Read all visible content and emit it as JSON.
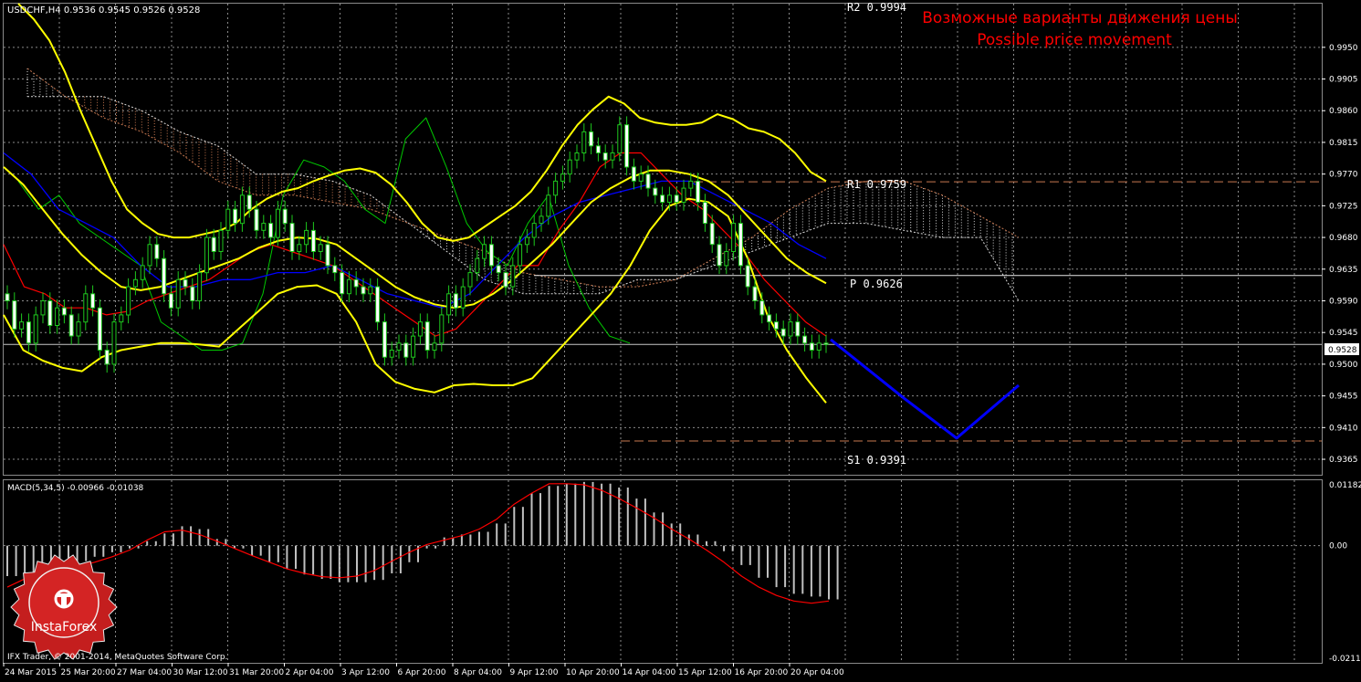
{
  "window": {
    "symbol_header": "USDCHF,H4  0.9536 0.9545 0.9526 0.9528",
    "macd_header": "MACD(5,34,5) -0.00966 -0.01038",
    "copyright": "IFX Trader, © 2001-2014, MetaQuotes Software Corp.",
    "watermark": "InstaForex"
  },
  "annotations": {
    "title_ru": "Возможные варианты движения цены",
    "title_en": "Possible price movement",
    "r2_label": "R2 0.9994",
    "r1_label": "R1 0.9759",
    "p_label": "P 0.9626",
    "s1_label": "S1 0.9391",
    "current_price_label": "0.9528"
  },
  "price_axis": {
    "ticks": [
      "0.9950",
      "0.9905",
      "0.9860",
      "0.9815",
      "0.9770",
      "0.9725",
      "0.9680",
      "0.9635",
      "0.9590",
      "0.9545",
      "0.9500",
      "0.9455",
      "0.9410",
      "0.9365"
    ]
  },
  "macd_axis": {
    "ticks": [
      "0.01182",
      "0.00",
      "-0.02117"
    ]
  },
  "time_axis": {
    "ticks": [
      "24 Mar 2015",
      "25 Mar 20:00",
      "27 Mar 04:00",
      "30 Mar 12:00",
      "31 Mar 20:00",
      "2 Apr 04:00",
      "3 Apr 12:00",
      "6 Apr 20:00",
      "8 Apr 04:00",
      "9 Apr 12:00",
      "10 Apr 20:00",
      "14 Apr 04:00",
      "15 Apr 12:00",
      "16 Apr 20:00",
      "20 Apr 04:00"
    ]
  },
  "colors": {
    "background": "#000000",
    "grid": "#8a8a8a",
    "candle": "#1ec81e",
    "bollinger": "#ffff00",
    "tenkan": "#ff0000",
    "kijun": "#0000ff",
    "chikou": "#00c800",
    "projection": "#0000ff",
    "pivot_levels": "#c87850",
    "macd_hist": "#c0c0c0",
    "macd_signal": "#ff0000",
    "annotation_text": "#ff0000",
    "axis_text": "#ffffff"
  },
  "chart_data": {
    "type": "line",
    "symbol": "USDCHF",
    "timeframe": "H4",
    "last_bar": {
      "open": 0.9536,
      "high": 0.9545,
      "low": 0.9526,
      "close": 0.9528
    },
    "ylim": [
      0.9343,
      1.0012
    ],
    "pivot_levels": {
      "R2": 0.9994,
      "R1": 0.9759,
      "P": 0.9626,
      "S1": 0.9391
    },
    "current_price": 0.9528,
    "closes": [
      0.959,
      0.955,
      0.956,
      0.953,
      0.957,
      0.959,
      0.9555,
      0.958,
      0.957,
      0.954,
      0.956,
      0.96,
      0.958,
      0.952,
      0.95,
      0.956,
      0.957,
      0.961,
      0.962,
      0.964,
      0.967,
      0.965,
      0.96,
      0.958,
      0.962,
      0.961,
      0.959,
      0.963,
      0.968,
      0.966,
      0.969,
      0.972,
      0.97,
      0.974,
      0.972,
      0.969,
      0.97,
      0.968,
      0.972,
      0.97,
      0.966,
      0.967,
      0.969,
      0.966,
      0.967,
      0.964,
      0.963,
      0.96,
      0.962,
      0.961,
      0.96,
      0.961,
      0.956,
      0.951,
      0.952,
      0.953,
      0.951,
      0.954,
      0.956,
      0.952,
      0.953,
      0.957,
      0.96,
      0.958,
      0.961,
      0.963,
      0.965,
      0.967,
      0.964,
      0.963,
      0.961,
      0.964,
      0.967,
      0.968,
      0.97,
      0.971,
      0.974,
      0.976,
      0.977,
      0.979,
      0.98,
      0.983,
      0.981,
      0.98,
      0.979,
      0.98,
      0.984,
      0.978,
      0.976,
      0.977,
      0.975,
      0.974,
      0.973,
      0.974,
      0.973,
      0.975,
      0.976,
      0.973,
      0.97,
      0.967,
      0.964,
      0.966,
      0.97,
      0.964,
      0.961,
      0.959,
      0.957,
      0.956,
      0.955,
      0.954,
      0.956,
      0.954,
      0.953,
      0.952,
      0.953,
      0.9528
    ],
    "bollinger_upper": [
      1.0012,
      0.999,
      0.996,
      0.9915,
      0.986,
      0.981,
      0.976,
      0.972,
      0.97,
      0.9685,
      0.968,
      0.968,
      0.9685,
      0.969,
      0.97,
      0.972,
      0.9735,
      0.9745,
      0.975,
      0.976,
      0.9768,
      0.9775,
      0.9778,
      0.9772,
      0.9755,
      0.973,
      0.97,
      0.968,
      0.9675,
      0.968,
      0.9695,
      0.971,
      0.9725,
      0.9745,
      0.9775,
      0.981,
      0.984,
      0.9862,
      0.988,
      0.987,
      0.985,
      0.9843,
      0.984,
      0.984,
      0.9843,
      0.9855,
      0.9848,
      0.9835,
      0.983,
      0.982,
      0.98,
      0.9773,
      0.976
    ],
    "bollinger_mid": [
      0.978,
      0.9755,
      0.972,
      0.9685,
      0.9655,
      0.963,
      0.961,
      0.9605,
      0.961,
      0.962,
      0.963,
      0.964,
      0.965,
      0.9665,
      0.9675,
      0.968,
      0.9678,
      0.967,
      0.965,
      0.963,
      0.961,
      0.9595,
      0.9585,
      0.958,
      0.9585,
      0.96,
      0.962,
      0.9645,
      0.967,
      0.97,
      0.973,
      0.975,
      0.9765,
      0.9775,
      0.9775,
      0.977,
      0.976,
      0.974,
      0.971,
      0.968,
      0.965,
      0.963,
      0.9615
    ],
    "bollinger_lower": [
      0.957,
      0.952,
      0.9505,
      0.9495,
      0.949,
      0.951,
      0.952,
      0.9525,
      0.953,
      0.953,
      0.9528,
      0.9525,
      0.955,
      0.9575,
      0.96,
      0.961,
      0.9612,
      0.96,
      0.956,
      0.95,
      0.9475,
      0.9465,
      0.946,
      0.947,
      0.9472,
      0.947,
      0.947,
      0.948,
      0.951,
      0.954,
      0.957,
      0.96,
      0.964,
      0.969,
      0.9725,
      0.9735,
      0.973,
      0.971,
      0.965,
      0.957,
      0.952,
      0.948,
      0.9445
    ],
    "tenkan_sen": [
      0.967,
      0.961,
      0.96,
      0.958,
      0.958,
      0.957,
      0.9575,
      0.959,
      0.96,
      0.961,
      0.962,
      0.964,
      0.966,
      0.967,
      0.966,
      0.965,
      0.964,
      0.962,
      0.96,
      0.958,
      0.956,
      0.954,
      0.955,
      0.958,
      0.961,
      0.964,
      0.964,
      0.969,
      0.973,
      0.978,
      0.98,
      0.98,
      0.977,
      0.974,
      0.972,
      0.969,
      0.966,
      0.962,
      0.959,
      0.956,
      0.954
    ],
    "kijun_sen": [
      0.98,
      0.977,
      0.972,
      0.97,
      0.968,
      0.964,
      0.961,
      0.961,
      0.962,
      0.962,
      0.963,
      0.963,
      0.964,
      0.962,
      0.96,
      0.959,
      0.958,
      0.96,
      0.964,
      0.968,
      0.971,
      0.973,
      0.974,
      0.975,
      0.976,
      0.976,
      0.974,
      0.972,
      0.97,
      0.967,
      0.965
    ],
    "chikou_span": [
      0.976,
      0.972,
      0.974,
      0.97,
      0.968,
      0.966,
      0.964,
      0.956,
      0.954,
      0.952,
      0.952,
      0.953,
      0.96,
      0.974,
      0.979,
      0.978,
      0.976,
      0.972,
      0.97,
      0.982,
      0.985,
      0.978,
      0.97,
      0.966,
      0.964,
      0.97,
      0.974,
      0.964,
      0.958,
      0.954,
      0.953
    ],
    "projection": {
      "x": [
        "20 Apr 04:00",
        "+6 bars",
        "+30 bars",
        "+40 bars"
      ],
      "price": [
        0.9535,
        0.9452,
        0.9395,
        0.947
      ]
    },
    "macd_hist": [
      -0.0055,
      -0.005,
      -0.0042,
      -0.0035,
      -0.0028,
      -0.002,
      -0.0012,
      -0.0005,
      0.0008,
      0.0022,
      0.0035,
      0.003,
      0.0012,
      -0.0005,
      -0.0018,
      -0.003,
      -0.0042,
      -0.0052,
      -0.006,
      -0.0066,
      -0.0066,
      -0.0062,
      -0.005,
      -0.003,
      -0.0005,
      0.0015,
      0.002,
      0.0025,
      0.004,
      0.007,
      0.0095,
      0.0108,
      0.0112,
      0.0115,
      0.0112,
      0.0105,
      0.0085,
      0.006,
      0.004,
      0.002,
      0.0008,
      -0.001,
      -0.0035,
      -0.0058,
      -0.0075,
      -0.0087,
      -0.0092,
      -0.0097
    ],
    "macd_signal": [
      -0.0075,
      -0.006,
      -0.005,
      -0.0045,
      -0.0038,
      -0.003,
      -0.002,
      -0.0008,
      0.001,
      0.0025,
      0.0028,
      0.002,
      0.0008,
      -0.0005,
      -0.0018,
      -0.003,
      -0.0042,
      -0.005,
      -0.0056,
      -0.0058,
      -0.0055,
      -0.0045,
      -0.0028,
      -0.0012,
      0.0002,
      0.001,
      0.0018,
      0.003,
      0.0048,
      0.0075,
      0.0095,
      0.0112,
      0.0112,
      0.011,
      0.01,
      0.0085,
      0.0068,
      0.005,
      0.003,
      0.0012,
      -0.0008,
      -0.003,
      -0.0055,
      -0.0075,
      -0.009,
      -0.01,
      -0.0104,
      -0.01
    ],
    "macd_ylim": [
      -0.02117,
      0.01182
    ]
  }
}
